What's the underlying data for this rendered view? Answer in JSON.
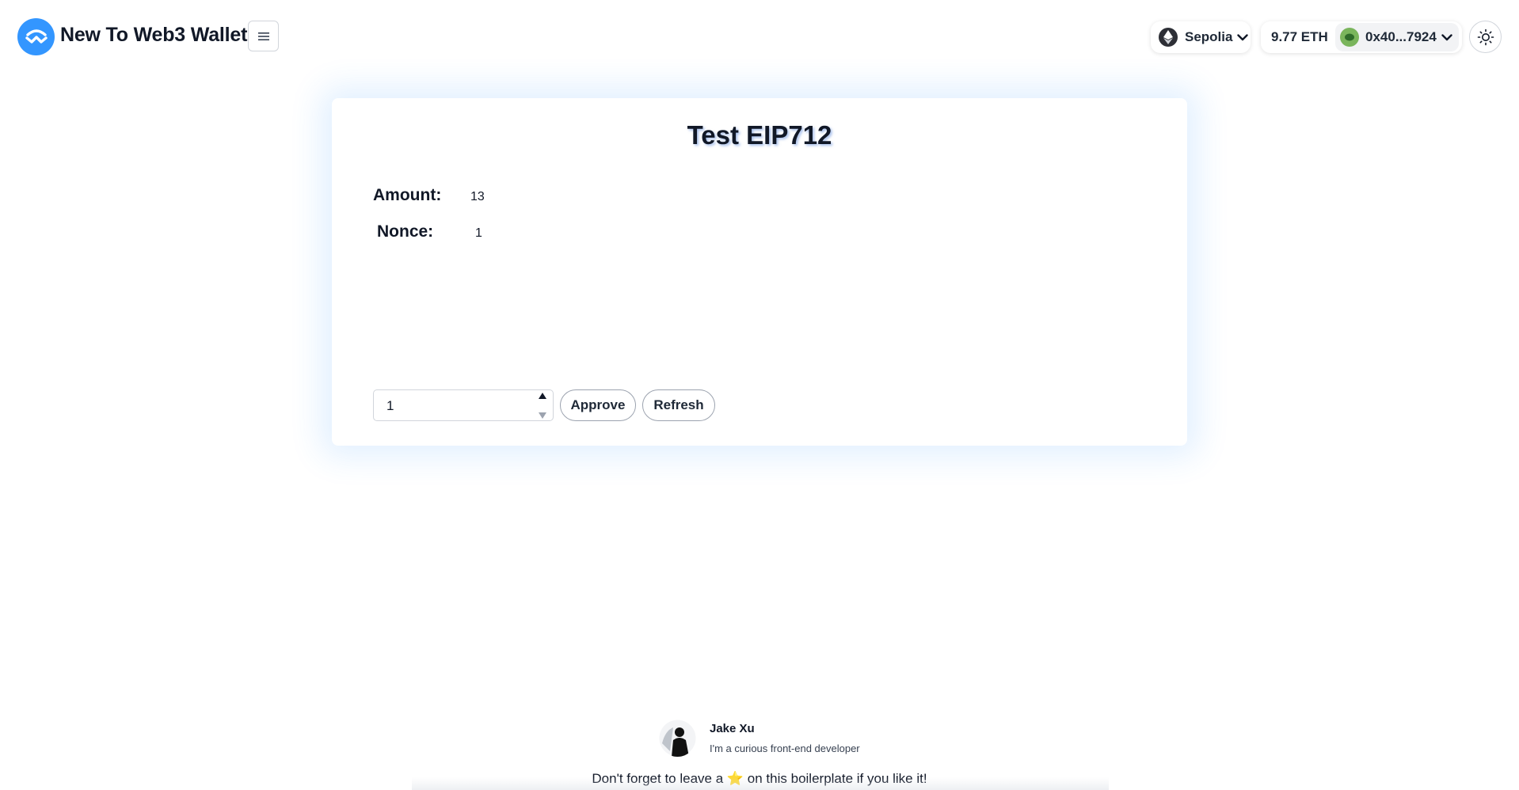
{
  "header": {
    "app_title": "New To Web3 Wallet",
    "logo_icon": "walletconnect-logo-icon",
    "menu_icon": "hamburger-menu-icon",
    "network": {
      "label": "Sepolia",
      "icon": "ethereum-icon"
    },
    "account": {
      "balance": "9.77 ETH",
      "address": "0x40...7924",
      "avatar_icon": "account-avatar-icon"
    },
    "theme_icon": "sun-icon"
  },
  "card": {
    "title": "Test EIP712",
    "fields": [
      {
        "label": "Amount:",
        "value": "13"
      },
      {
        "label": "Nonce:",
        "value": "1"
      }
    ],
    "input_value": "1",
    "approve_label": "Approve",
    "refresh_label": "Refresh"
  },
  "footer": {
    "author_name": "Jake Xu",
    "author_bio": "I'm a curious front-end developer",
    "note_before": "Don't forget to leave a ",
    "note_star": "⭐",
    "note_after": " on this boilerplate if you like it!"
  },
  "colors": {
    "brand": "#3396ff",
    "text": "#111827"
  }
}
